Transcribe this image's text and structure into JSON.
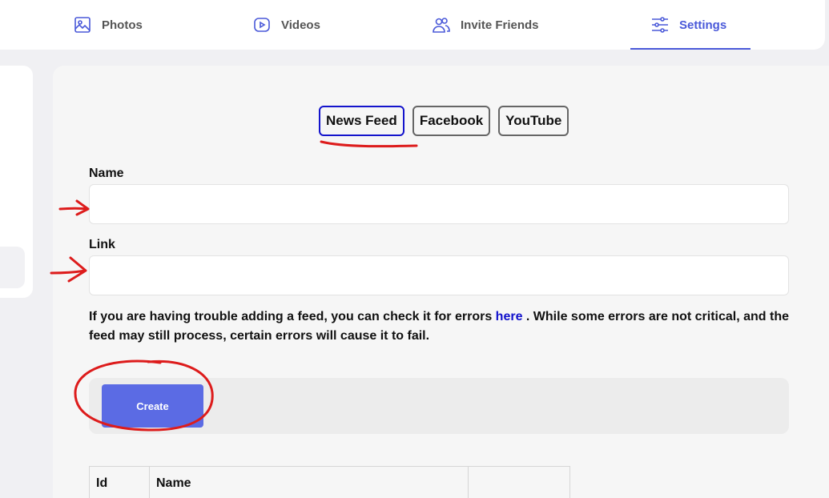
{
  "nav": {
    "items": [
      {
        "label": "Photos",
        "icon": "photos-icon"
      },
      {
        "label": "Videos",
        "icon": "videos-icon"
      },
      {
        "label": "Invite Friends",
        "icon": "invite-friends-icon"
      },
      {
        "label": "Settings",
        "icon": "settings-icon"
      }
    ],
    "active_index": 3
  },
  "tabs": [
    {
      "label": "News Feed",
      "active": true
    },
    {
      "label": "Facebook",
      "active": false
    },
    {
      "label": "YouTube",
      "active": false
    }
  ],
  "form": {
    "name_label": "Name",
    "name_value": "",
    "link_label": "Link",
    "link_value": ""
  },
  "help": {
    "before": "If you are having trouble adding a feed, you can check it for errors ",
    "link_text": "here",
    "after": " . While some errors are not critical, and the feed may still process, certain errors will cause it to fail."
  },
  "create_label": "Create",
  "table": {
    "headers": [
      "Id",
      "Name",
      ""
    ]
  },
  "colors": {
    "accent": "#4a59d9",
    "button": "#5b6be4",
    "link": "#1111cc",
    "annotation": "#dd1c1c"
  }
}
